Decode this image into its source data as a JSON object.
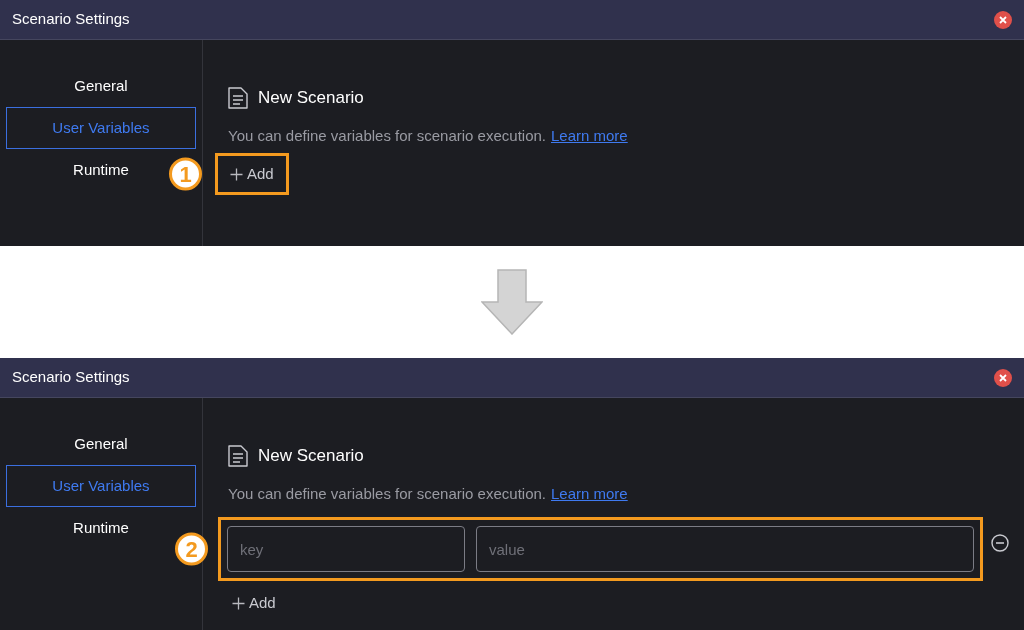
{
  "panels": [
    {
      "window": {
        "title": "Scenario Settings"
      },
      "sidebar": {
        "items": [
          {
            "label": "General",
            "selected": false
          },
          {
            "label": "User Variables",
            "selected": true
          },
          {
            "label": "Runtime",
            "selected": false
          }
        ]
      },
      "content": {
        "title": "New Scenario",
        "description": "You can define variables for scenario execution.",
        "link": "Learn more",
        "add_label": "Add"
      },
      "callout": {
        "number": "1",
        "kind": "add"
      }
    },
    {
      "window": {
        "title": "Scenario Settings"
      },
      "sidebar": {
        "items": [
          {
            "label": "General",
            "selected": false
          },
          {
            "label": "User Variables",
            "selected": true
          },
          {
            "label": "Runtime",
            "selected": false
          }
        ]
      },
      "content": {
        "title": "New Scenario",
        "description": "You can define variables for scenario execution.",
        "link": "Learn more",
        "variables": [
          {
            "key_placeholder": "key",
            "value_placeholder": "value"
          }
        ],
        "add_label": "Add"
      },
      "callout": {
        "number": "2",
        "kind": "variables"
      }
    }
  ]
}
